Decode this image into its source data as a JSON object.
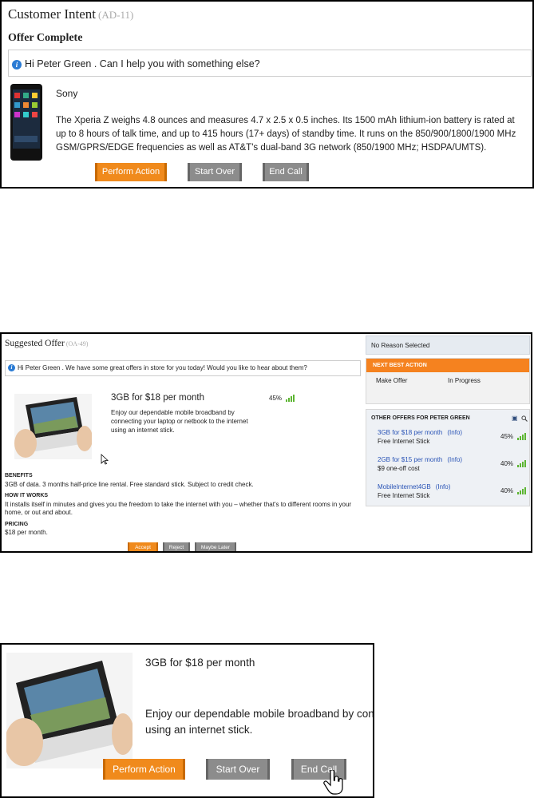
{
  "panel1": {
    "title": "Customer Intent",
    "title_id": "(AD-11)",
    "subtitle": "Offer Complete",
    "message": "Hi Peter Green . Can I help you with something else?",
    "product_brand": "Sony",
    "product_description": "The Xperia Z weighs 4.8 ounces and measures 4.7 x 2.5 x 0.5 inches. Its 1500 mAh lithium-ion battery is rated at up to 8 hours of talk time, and up to 415 hours (17+ days) of standby time. It runs on the 850/900/1800/1900 MHz GSM/GPRS/EDGE frequencies as well as AT&T's dual-band 3G network (850/1900 MHz; HSDPA/UMTS).",
    "buttons": {
      "perform": "Perform Action",
      "start_over": "Start Over",
      "end_call": "End Call"
    }
  },
  "panel2": {
    "title": "Suggested Offer",
    "title_id": "(OA-49)",
    "message": "Hi Peter Green . We have some great offers in store for you today! Would you like to hear about them?",
    "offer": {
      "title": "3GB for $18 per month",
      "percent": "45%",
      "description": "Enjoy our dependable mobile broadband by connecting your laptop or netbook to the internet using an internet stick."
    },
    "benefits_label": "BENEFITS",
    "benefits_text": "3GB of data. 3 months half-price line rental. Free standard stick. Subject to credit check.",
    "how_label": "HOW IT WORKS",
    "how_text": "It installs itself in minutes and gives you the freedom to take the internet with you – whether that's to different rooms in your home, or out and about.",
    "pricing_label": "PRICING",
    "pricing_text": "$18 per month.",
    "buttons": {
      "accept": "Accept",
      "reject": "Reject",
      "maybe_later": "Maybe Later"
    },
    "side": {
      "no_reason": "No Reason Selected",
      "nba_header": "NEXT BEST ACTION",
      "nba_action": "Make Offer",
      "nba_status": "In Progress",
      "others_header": "OTHER OFFERS FOR PETER GREEN",
      "info_label": "(Info)",
      "offers": [
        {
          "name": "3GB for $18 per month",
          "sub": "Free Internet Stick",
          "percent": "45%"
        },
        {
          "name": "2GB for $15 per month",
          "sub": "$9 one-off cost",
          "percent": "40%"
        },
        {
          "name": "MobileInternet4GB",
          "sub": "Free Internet Stick",
          "percent": "40%"
        }
      ]
    }
  },
  "panel3": {
    "offer_title": "3GB for $18 per month",
    "offer_line1": "Enjoy our dependable mobile broadband by conn",
    "offer_line2": "using an internet stick.",
    "buttons": {
      "perform": "Perform Action",
      "start_over": "Start Over",
      "end_call": "End Call"
    }
  },
  "colors": {
    "orange": "#f08a1c",
    "grey": "#8c8c8c",
    "link": "#2a54b6",
    "signal": "#5cb531",
    "info": "#2a7bd4"
  }
}
